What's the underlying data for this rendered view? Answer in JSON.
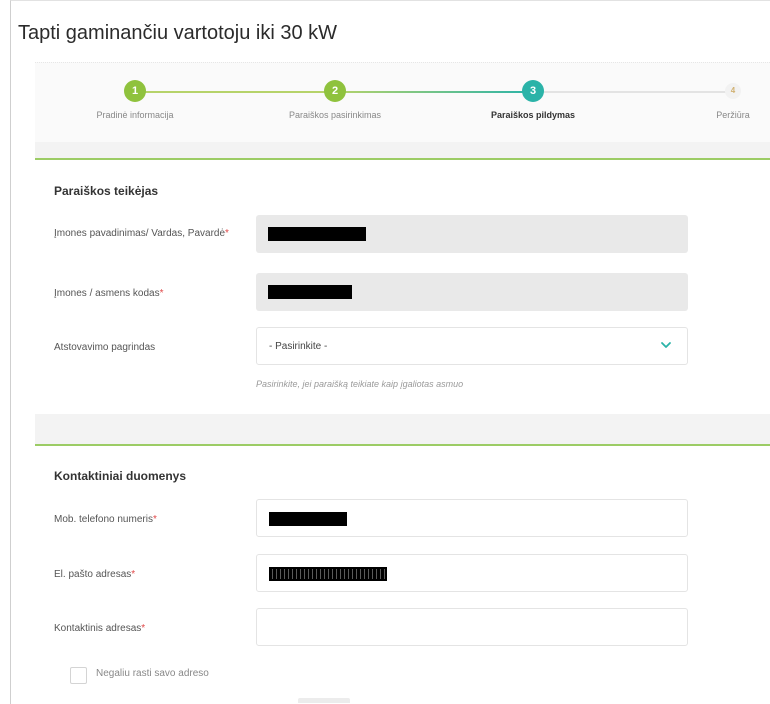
{
  "page": {
    "title": "Tapti gaminančiu vartotoju iki 30 kW"
  },
  "stepper": {
    "steps": [
      {
        "number": "1",
        "label": "Pradinė informacija",
        "state": "done"
      },
      {
        "number": "2",
        "label": "Paraiškos pasirinkimas",
        "state": "done"
      },
      {
        "number": "3",
        "label": "Paraiškos pildymas",
        "state": "active"
      },
      {
        "number": "4",
        "label": "Peržiūra",
        "state": "todo"
      }
    ],
    "colors": {
      "done": "#8fc23d",
      "active": "#2bb3a8",
      "line": "#b6d36a"
    }
  },
  "applicant": {
    "title": "Paraiškos teikėjas",
    "company_name": {
      "label": "Įmones pavadinimas/ Vardas, Pavardė",
      "required_mark": "*"
    },
    "company_code": {
      "label": "Įmones / asmens kodas",
      "required_mark": "*"
    },
    "representation": {
      "label": "Atstovavimo pagrindas",
      "value": "- Pasirinkite -",
      "hint": "Pasirinkite, jei paraišką teikiate kaip įgaliotas asmuo"
    }
  },
  "contacts": {
    "title": "Kontaktiniai duomenys",
    "phone": {
      "label": "Mob. telefono numeris",
      "required_mark": "*"
    },
    "email": {
      "label": "El. pašto adresas",
      "required_mark": "*"
    },
    "address": {
      "label": "Kontaktinis adresas",
      "required_mark": "*",
      "value": ""
    },
    "cannot_find_address": {
      "label": "Negaliu rasti savo adreso",
      "checked": false
    }
  },
  "colors": {
    "accent": "#9ccc65",
    "required": "#e04848",
    "readonly_bg": "#e9e9e9"
  }
}
